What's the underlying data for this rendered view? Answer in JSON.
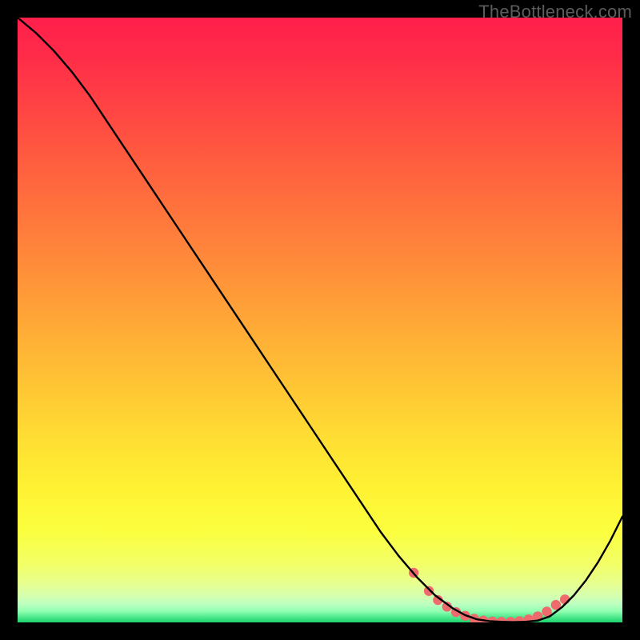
{
  "watermark": "TheBottleneck.com",
  "colors": {
    "frame": "#000000",
    "line": "#000000",
    "dot": "#ee6a6d"
  },
  "chart_data": {
    "type": "line",
    "title": "",
    "xlabel": "",
    "ylabel": "",
    "xlim": [
      0,
      100
    ],
    "ylim": [
      0,
      100
    ],
    "series": [
      {
        "name": "curve",
        "x": [
          0,
          3,
          6,
          9,
          12,
          15,
          18,
          21,
          24,
          27,
          30,
          33,
          36,
          39,
          42,
          45,
          48,
          51,
          54,
          57,
          60,
          63,
          66,
          69,
          72,
          74,
          76,
          78,
          80,
          82,
          84,
          86,
          88,
          90,
          92,
          94,
          96,
          98,
          100
        ],
        "y": [
          100,
          97.5,
          94.5,
          91,
          87,
          82.5,
          78,
          73.5,
          69,
          64.5,
          60,
          55.5,
          51,
          46.5,
          42,
          37.5,
          33,
          28.5,
          24,
          19.5,
          15,
          11,
          7.5,
          4.5,
          2.3,
          1.2,
          0.5,
          0.2,
          0.1,
          0.05,
          0.1,
          0.3,
          1.0,
          2.5,
          4.5,
          7,
          10,
          13.5,
          17.5
        ]
      },
      {
        "name": "dots",
        "x": [
          65.5,
          68.0,
          69.5,
          71.0,
          72.5,
          74.0,
          75.5,
          77.0,
          78.5,
          80.0,
          81.5,
          83.0,
          84.5,
          86.0,
          87.5,
          89.0,
          90.5
        ],
        "y": [
          8.2,
          5.2,
          3.7,
          2.6,
          1.7,
          1.1,
          0.6,
          0.3,
          0.15,
          0.1,
          0.1,
          0.2,
          0.5,
          1.0,
          1.8,
          2.9,
          3.8
        ]
      }
    ],
    "gradient_stops": [
      {
        "offset": 0.0,
        "color": "#ff1f4b"
      },
      {
        "offset": 0.06,
        "color": "#ff2b49"
      },
      {
        "offset": 0.14,
        "color": "#ff4144"
      },
      {
        "offset": 0.22,
        "color": "#ff5840"
      },
      {
        "offset": 0.3,
        "color": "#ff6e3d"
      },
      {
        "offset": 0.38,
        "color": "#ff843b"
      },
      {
        "offset": 0.46,
        "color": "#ff9b38"
      },
      {
        "offset": 0.54,
        "color": "#ffb236"
      },
      {
        "offset": 0.62,
        "color": "#ffc834"
      },
      {
        "offset": 0.7,
        "color": "#ffdf33"
      },
      {
        "offset": 0.78,
        "color": "#fff233"
      },
      {
        "offset": 0.85,
        "color": "#fbff3f"
      },
      {
        "offset": 0.905,
        "color": "#f2ff68"
      },
      {
        "offset": 0.935,
        "color": "#e7ff8e"
      },
      {
        "offset": 0.955,
        "color": "#d6ffad"
      },
      {
        "offset": 0.97,
        "color": "#bcffc0"
      },
      {
        "offset": 0.982,
        "color": "#8effb0"
      },
      {
        "offset": 0.991,
        "color": "#4fe98e"
      },
      {
        "offset": 1.0,
        "color": "#1dd36e"
      }
    ]
  }
}
